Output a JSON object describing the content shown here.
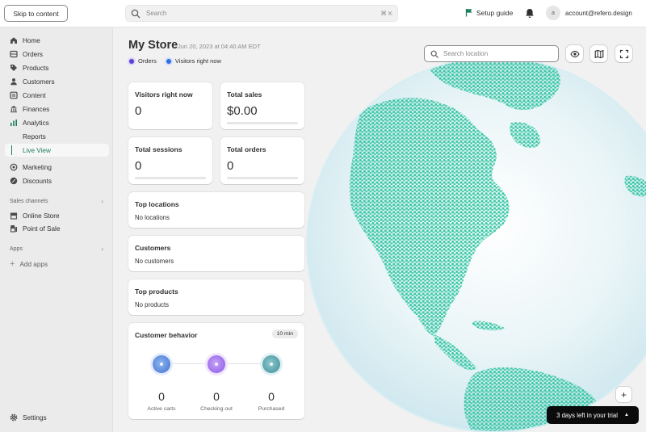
{
  "topbar": {
    "skip_label": "Skip to content",
    "search_placeholder": "Search",
    "search_shortcut": "⌘ K",
    "setup_label": "Setup guide",
    "account_initial": "a",
    "account_email": "account@refero.design"
  },
  "sidebar": {
    "items": [
      {
        "label": "Home",
        "icon": "home-icon"
      },
      {
        "label": "Orders",
        "icon": "orders-icon"
      },
      {
        "label": "Products",
        "icon": "tag-icon"
      },
      {
        "label": "Customers",
        "icon": "person-icon"
      },
      {
        "label": "Content",
        "icon": "content-icon"
      },
      {
        "label": "Finances",
        "icon": "bank-icon"
      },
      {
        "label": "Analytics",
        "icon": "chart-icon"
      },
      {
        "label": "Reports",
        "icon": ""
      },
      {
        "label": "Live View",
        "icon": "",
        "active": true
      },
      {
        "label": "Marketing",
        "icon": "target-icon"
      },
      {
        "label": "Discounts",
        "icon": "discount-icon"
      }
    ],
    "sales_channels_label": "Sales channels",
    "channels": [
      {
        "label": "Online Store",
        "icon": "store-icon"
      },
      {
        "label": "Point of Sale",
        "icon": "pos-icon"
      }
    ],
    "apps_label": "Apps",
    "add_apps_label": "Add apps",
    "settings_label": "Settings"
  },
  "main": {
    "title": "My Store",
    "date": "Jun 20, 2023 at 04:40 AM EDT",
    "legend": [
      {
        "label": "Orders",
        "color": "#5b3fd6"
      },
      {
        "label": "Visitors right now",
        "color": "#2f6fe0"
      }
    ],
    "metrics": [
      {
        "label": "Visitors right now",
        "value": "0"
      },
      {
        "label": "Total sales",
        "value": "$0.00"
      },
      {
        "label": "Total sessions",
        "value": "0"
      },
      {
        "label": "Total orders",
        "value": "0"
      }
    ],
    "top_locations": {
      "label": "Top locations",
      "empty": "No locations"
    },
    "customers": {
      "label": "Customers",
      "empty": "No customers"
    },
    "top_products": {
      "label": "Top products",
      "empty": "No products"
    },
    "behavior": {
      "label": "Customer behavior",
      "badge": "10 min",
      "stages": [
        {
          "label": "Active carts",
          "value": "0",
          "color": "#4a7fd8"
        },
        {
          "label": "Checking out",
          "value": "0",
          "color": "#8a55e6"
        },
        {
          "label": "Purchased",
          "value": "0",
          "color": "#3c8c99"
        }
      ]
    },
    "map": {
      "search_placeholder": "Search location",
      "trial_label": "3 days left in your trial",
      "land_color": "#3cc8a8",
      "ocean_color": "#e6f2f6"
    }
  }
}
